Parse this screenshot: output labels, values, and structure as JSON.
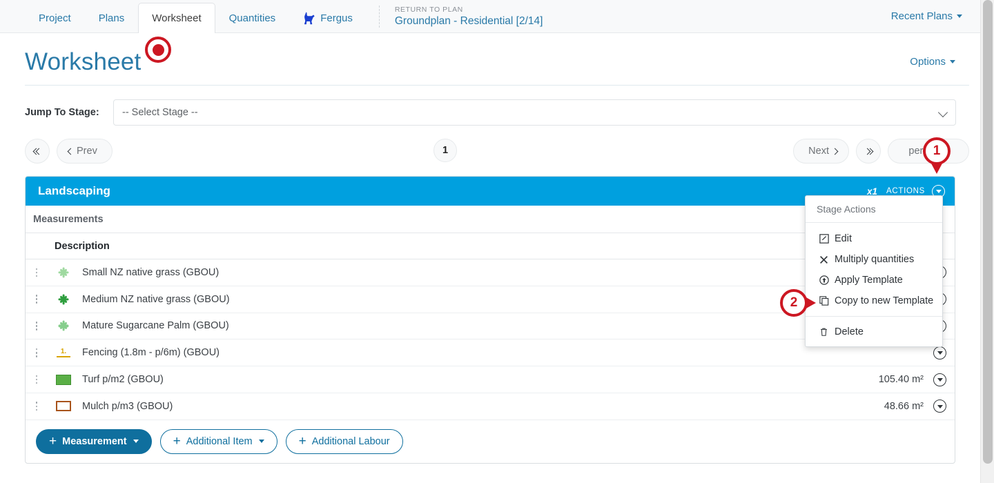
{
  "topnav": {
    "tabs": [
      {
        "label": "Project",
        "active": false,
        "icon": null
      },
      {
        "label": "Plans",
        "active": false,
        "icon": null
      },
      {
        "label": "Worksheet",
        "active": true,
        "icon": null
      },
      {
        "label": "Quantities",
        "active": false,
        "icon": null
      },
      {
        "label": "Fergus",
        "active": false,
        "icon": "dog-icon"
      }
    ],
    "plan_kicker": "RETURN TO PLAN",
    "plan_name": "Groundplan - Residential [2/14]",
    "recent_plans": "Recent Plans"
  },
  "header": {
    "page_title": "Worksheet",
    "options_label": "Options"
  },
  "jump_to_stage": {
    "label": "Jump To Stage:",
    "selected": "-- Select Stage --",
    "options": [
      "-- Select Stage --"
    ]
  },
  "pagination": {
    "first_label": "",
    "prev_label": "Prev",
    "current_page": "1",
    "next_label": "Next",
    "last_label": "",
    "per_page_label": "per page"
  },
  "stage": {
    "title": "Landscaping",
    "multiplier": "x1",
    "actions_label": "ACTIONS",
    "section_label": "Measurements",
    "columns": [
      "Description"
    ],
    "rows": [
      {
        "icon": "plant-small-icon",
        "icon_color": "#9fd9a0",
        "description": "Small NZ native grass (GBOU)",
        "quantity": ""
      },
      {
        "icon": "plant-medium-icon",
        "icon_color": "#2e9e3e",
        "description": "Medium NZ native grass (GBOU)",
        "quantity": ""
      },
      {
        "icon": "plant-palm-icon",
        "icon_color": "#86ce8c",
        "description": "Mature Sugarcane Palm (GBOU)",
        "quantity": ""
      },
      {
        "icon": "fence-icon",
        "icon_color": "#d9a400",
        "description": "Fencing (1.8m - p/6m) (GBOU)",
        "quantity": ""
      },
      {
        "icon": "swatch-filled-icon",
        "icon_color": "#5aaf46",
        "description": "Turf p/m2 (GBOU)",
        "quantity": "105.40 m²"
      },
      {
        "icon": "swatch-outline-icon",
        "icon_color": "#a8531b",
        "description": "Mulch p/m3 (GBOU)",
        "quantity": "48.66 m²"
      }
    ],
    "footer_buttons": [
      {
        "label": "Measurement",
        "style": "primary",
        "has_caret": true
      },
      {
        "label": "Additional Item",
        "style": "ghost",
        "has_caret": true
      },
      {
        "label": "Additional Labour",
        "style": "ghost",
        "has_caret": false
      }
    ]
  },
  "stage_actions_menu": {
    "header": "Stage Actions",
    "items": [
      {
        "label": "Edit",
        "icon": "edit-square-icon"
      },
      {
        "label": "Multiply quantities",
        "icon": "close-x-icon"
      },
      {
        "label": "Apply Template",
        "icon": "arrow-up-circle-icon"
      },
      {
        "label": "Copy to new Template",
        "icon": "copy-icon"
      },
      {
        "label": "Delete",
        "icon": "trash-icon"
      }
    ]
  },
  "annotations": [
    {
      "number": "1",
      "direction": "down"
    },
    {
      "number": "2",
      "direction": "right"
    }
  ],
  "colors": {
    "accent_blue": "#00a0df",
    "link_blue": "#2a7aa8",
    "button_blue": "#0f6f9e",
    "marker_red": "#cc1722"
  }
}
